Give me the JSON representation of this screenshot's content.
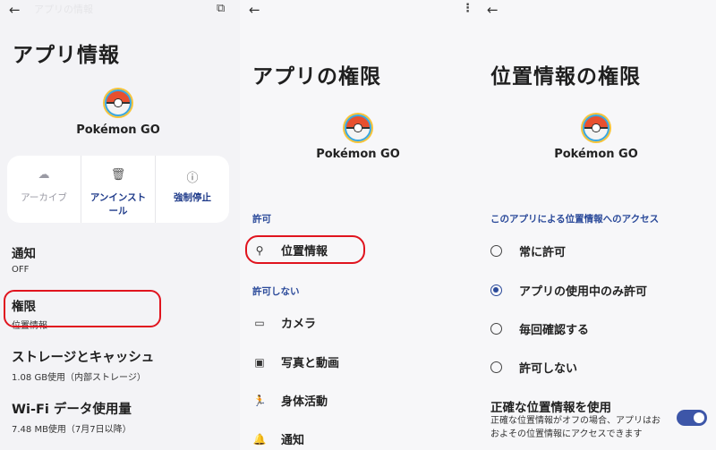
{
  "panel1": {
    "top_title_faded": "アプリの情報",
    "title": "アプリ情報",
    "app_name": "Pokémon GO",
    "actions": [
      {
        "label": "アーカイブ",
        "icon": "cloud-upload-icon",
        "enabled": false
      },
      {
        "label": "アンインストール",
        "icon": "trash-icon",
        "enabled": true
      },
      {
        "label": "強制停止",
        "icon": "stop-icon",
        "enabled": true
      }
    ],
    "items": [
      {
        "title": "通知",
        "subtitle": "OFF"
      },
      {
        "title": "権限",
        "subtitle": "位置情報"
      },
      {
        "title": "ストレージとキャッシュ",
        "subtitle": "1.08 GB使用（内部ストレージ）"
      },
      {
        "title": "Wi-Fi データ使用量",
        "subtitle": "7.48 MB使用（7月7日以降）"
      }
    ]
  },
  "panel2": {
    "title": "アプリの権限",
    "app_name": "Pokémon GO",
    "allowed_header": "許可",
    "allowed": [
      {
        "label": "位置情報",
        "icon": "location-pin-icon"
      }
    ],
    "denied_header": "許可しない",
    "denied": [
      {
        "label": "カメラ",
        "icon": "camera-icon"
      },
      {
        "label": "写真と動画",
        "icon": "photo-library-icon"
      },
      {
        "label": "身体活動",
        "icon": "running-icon"
      },
      {
        "label": "通知",
        "icon": "bell-icon"
      }
    ]
  },
  "panel3": {
    "title": "位置情報の権限",
    "app_name": "Pokémon GO",
    "section_header": "このアプリによる位置情報へのアクセス",
    "options": [
      {
        "label": "常に許可",
        "checked": false
      },
      {
        "label": "アプリの使用中のみ許可",
        "checked": true
      },
      {
        "label": "毎回確認する",
        "checked": false
      },
      {
        "label": "許可しない",
        "checked": false
      }
    ],
    "precise_title": "正確な位置情報を使用",
    "precise_desc": "正確な位置情報がオフの場合、アプリはおおよその位置情報にアクセスできます",
    "precise_enabled": true
  },
  "colors": {
    "accent": "#2b4a9a",
    "highlight": "#e0141e",
    "toggle_on": "#3d56a8"
  }
}
